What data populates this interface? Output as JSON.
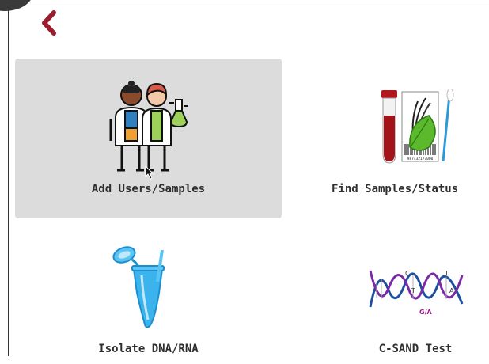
{
  "tiles": [
    {
      "label": "Add Users/Samples",
      "icon": "scientists-icon"
    },
    {
      "label": "Find Samples/Status",
      "icon": "sample-tube-leaf-icon"
    },
    {
      "label": "Isolate DNA/RNA",
      "icon": "microtube-icon"
    },
    {
      "label": "C-SAND Test",
      "icon": "dna-helix-icon"
    }
  ],
  "dna_labels": {
    "c": "C",
    "t1": "T",
    "t2": "T",
    "a": "A",
    "ga": "G/A"
  },
  "barcode_text": "987432177000",
  "colors": {
    "accent": "#9b1c2e",
    "tile_active": "#dcdcdd",
    "frame": "#333333"
  }
}
